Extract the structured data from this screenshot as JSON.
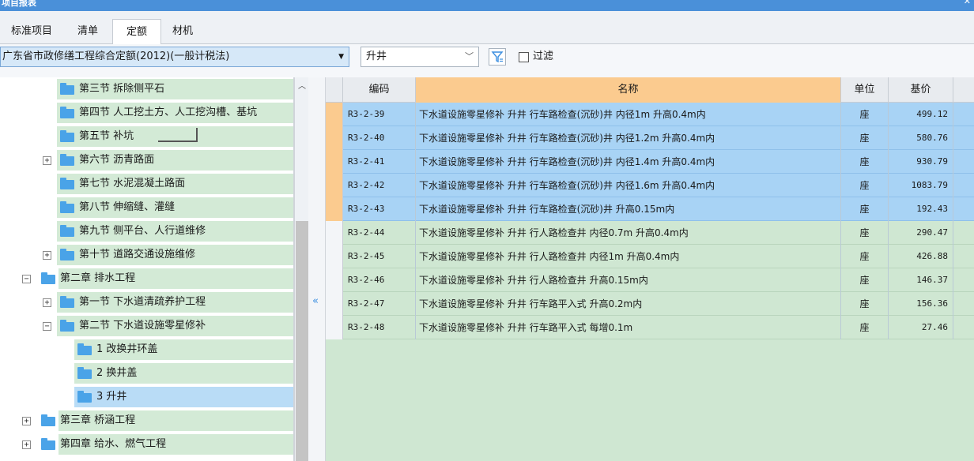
{
  "window": {
    "title": "项目报表"
  },
  "tabs": [
    {
      "label": "标准项目",
      "active": false
    },
    {
      "label": "清单",
      "active": false
    },
    {
      "label": "定额",
      "active": true
    },
    {
      "label": "材机",
      "active": false
    }
  ],
  "toolbar": {
    "library": "广东省市政修缮工程综合定额(2012)(一般计税法)",
    "search_value": "升井",
    "filter_label": "过滤",
    "filter_checked": false
  },
  "tree": [
    {
      "label": "第三节 拆除侧平石",
      "level": 2,
      "expander": "",
      "selected": false
    },
    {
      "label": "第四节 人工挖土方、人工挖沟槽、基坑",
      "level": 2,
      "expander": "",
      "selected": false
    },
    {
      "label": "第五节 补坑",
      "level": 2,
      "expander": "",
      "selected": false
    },
    {
      "label": "第六节 沥青路面",
      "level": 2,
      "expander": "+",
      "selected": false
    },
    {
      "label": "第七节 水泥混凝土路面",
      "level": 2,
      "expander": "",
      "selected": false
    },
    {
      "label": "第八节 伸缩缝、灌缝",
      "level": 2,
      "expander": "",
      "selected": false
    },
    {
      "label": "第九节 侧平台、人行道维修",
      "level": 2,
      "expander": "",
      "selected": false
    },
    {
      "label": "第十节 道路交通设施维修",
      "level": 2,
      "expander": "+",
      "selected": false
    },
    {
      "label": "第二章 排水工程",
      "level": 1,
      "expander": "−",
      "selected": false
    },
    {
      "label": "第一节 下水道清疏养护工程",
      "level": 2,
      "expander": "+",
      "selected": false
    },
    {
      "label": "第二节 下水道设施零星修补",
      "level": 2,
      "expander": "−",
      "selected": false
    },
    {
      "label": "1 改换井环盖",
      "level": 3,
      "expander": "",
      "selected": false
    },
    {
      "label": "2 换井盖",
      "level": 3,
      "expander": "",
      "selected": false
    },
    {
      "label": "3 升井",
      "level": 3,
      "expander": "",
      "selected": true
    },
    {
      "label": "第三章 桥涵工程",
      "level": 1,
      "expander": "+",
      "selected": false
    },
    {
      "label": "第四章 给水、燃气工程",
      "level": 1,
      "expander": "+",
      "selected": false
    }
  ],
  "grid": {
    "headers": {
      "code": "编码",
      "name": "名称",
      "unit": "单位",
      "price": "基价"
    },
    "rows": [
      {
        "code": "R3-2-39",
        "name": "下水道设施零星修补 升井 行车路检查(沉砂)井 内径1m 升高0.4m内",
        "unit": "座",
        "price": "499.12",
        "selected": true
      },
      {
        "code": "R3-2-40",
        "name": "下水道设施零星修补 升井 行车路检查(沉砂)井 内径1.2m 升高0.4m内",
        "unit": "座",
        "price": "580.76",
        "selected": true
      },
      {
        "code": "R3-2-41",
        "name": "下水道设施零星修补 升井 行车路检查(沉砂)井 内径1.4m 升高0.4m内",
        "unit": "座",
        "price": "930.79",
        "selected": true
      },
      {
        "code": "R3-2-42",
        "name": "下水道设施零星修补 升井 行车路检查(沉砂)井 内径1.6m 升高0.4m内",
        "unit": "座",
        "price": "1083.79",
        "selected": true
      },
      {
        "code": "R3-2-43",
        "name": "下水道设施零星修补 升井 行车路检查(沉砂)井 升高0.15m内",
        "unit": "座",
        "price": "192.43",
        "selected": true
      },
      {
        "code": "R3-2-44",
        "name": "下水道设施零星修补 升井 行人路检查井  内径0.7m 升高0.4m内",
        "unit": "座",
        "price": "290.47",
        "selected": false
      },
      {
        "code": "R3-2-45",
        "name": "下水道设施零星修补 升井 行人路检查井  内径1m 升高0.4m内",
        "unit": "座",
        "price": "426.88",
        "selected": false
      },
      {
        "code": "R3-2-46",
        "name": "下水道设施零星修补 升井 行人路检查井 升高0.15m内",
        "unit": "座",
        "price": "146.37",
        "selected": false
      },
      {
        "code": "R3-2-47",
        "name": "下水道设施零星修补 升井 行车路平入式 升高0.2m内",
        "unit": "座",
        "price": "156.36",
        "selected": false
      },
      {
        "code": "R3-2-48",
        "name": "下水道设施零星修补 升井 行车路平入式 每增0.1m",
        "unit": "座",
        "price": "27.46",
        "selected": false
      }
    ]
  }
}
